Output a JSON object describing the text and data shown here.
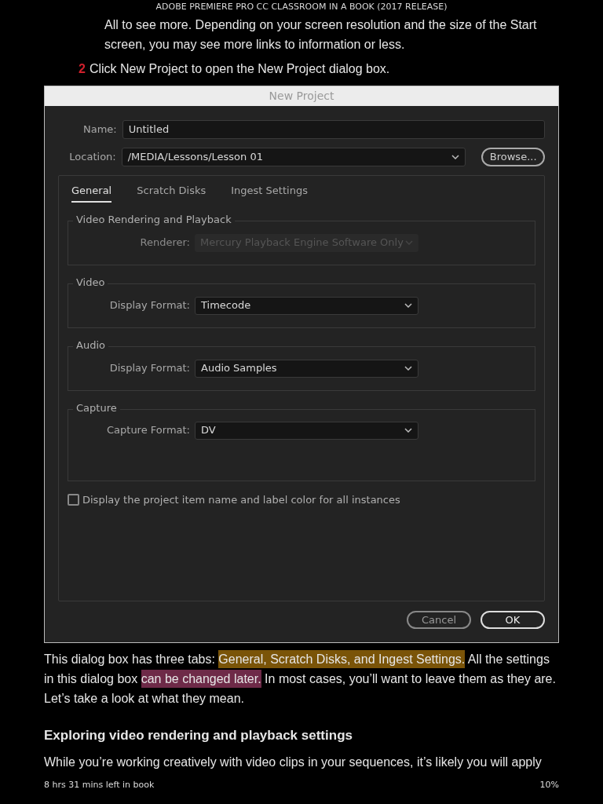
{
  "header": {
    "title": "ADOBE PREMIERE PRO CC CLASSROOM IN A BOOK (2017 RELEASE)"
  },
  "bullet_continuation": [
    "All to see more. Depending on your screen resolution and the size of the Start",
    "screen, you may see more links to information or less."
  ],
  "step": {
    "number": "2",
    "text": "Click New Project to open the New Project dialog box."
  },
  "dialog": {
    "title": "New Project",
    "name_field": {
      "label": "Name:",
      "value": "Untitled"
    },
    "location_field": {
      "label": "Location:",
      "value": "/MEDIA/Lessons/Lesson 01"
    },
    "browse_button": "Browse...",
    "tabs": [
      {
        "label": "General",
        "selected": true
      },
      {
        "label": "Scratch Disks",
        "selected": false
      },
      {
        "label": "Ingest Settings",
        "selected": false
      }
    ],
    "groups": [
      {
        "title": "Video Rendering and Playback",
        "label": "Renderer:",
        "value": "Mercury Playback Engine Software Only",
        "disabled": true,
        "tall": false
      },
      {
        "title": "Video",
        "label": "Display Format:",
        "value": "Timecode",
        "disabled": false,
        "tall": false
      },
      {
        "title": "Audio",
        "label": "Display Format:",
        "value": "Audio Samples",
        "disabled": false,
        "tall": false
      },
      {
        "title": "Capture",
        "label": "Capture Format:",
        "value": "DV",
        "disabled": false,
        "tall": true
      }
    ],
    "checkbox": {
      "label": "Display the project item name and label color for all instances",
      "checked": false
    },
    "buttons": [
      {
        "label": "Cancel",
        "kind": "secondary"
      },
      {
        "label": "OK",
        "kind": "default"
      }
    ]
  },
  "paragraph": [
    {
      "text": "This dialog box has three tabs: "
    },
    {
      "text": "General, Scratch Disks, and Ingest Settings.",
      "color": "#7a5408"
    },
    {
      "text": " All the settings in this dialog box "
    },
    {
      "text": "can be changed later.",
      "color": "#6e2a48"
    },
    {
      "text": " In most cases, you’ll want to leave them as they are. Let’s take a look at what they mean."
    }
  ],
  "heading": "Exploring video rendering and playback settings",
  "next_paragraph_line": "While you’re working creatively with video clips in your sequences, it’s likely you will apply",
  "footer": {
    "time_left": "8 hrs 31 mins left in book",
    "progress": "10%"
  }
}
